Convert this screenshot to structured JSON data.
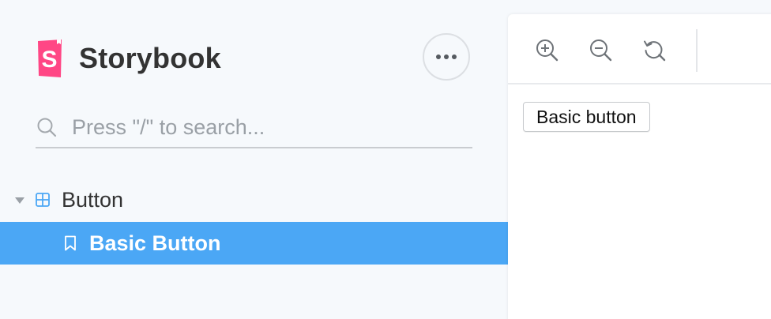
{
  "app": {
    "brand_name": "Storybook",
    "brand_color": "#FF4785"
  },
  "sidebar": {
    "menu_icon": "ellipsis-icon",
    "search": {
      "placeholder": "Press \"/\" to search...",
      "value": ""
    },
    "tree": {
      "component": {
        "label": "Button",
        "expanded": true,
        "icon": "component-grid-icon"
      },
      "stories": [
        {
          "label": "Basic Button",
          "selected": true,
          "icon": "bookmark-icon"
        }
      ]
    },
    "selected_color": "#4BA7F5"
  },
  "toolbar": {
    "tools": [
      {
        "name": "zoom-in",
        "icon": "zoom-in-icon"
      },
      {
        "name": "zoom-out",
        "icon": "zoom-out-icon"
      },
      {
        "name": "reset-zoom",
        "icon": "reset-zoom-icon"
      }
    ]
  },
  "preview": {
    "button_label": "Basic button"
  }
}
